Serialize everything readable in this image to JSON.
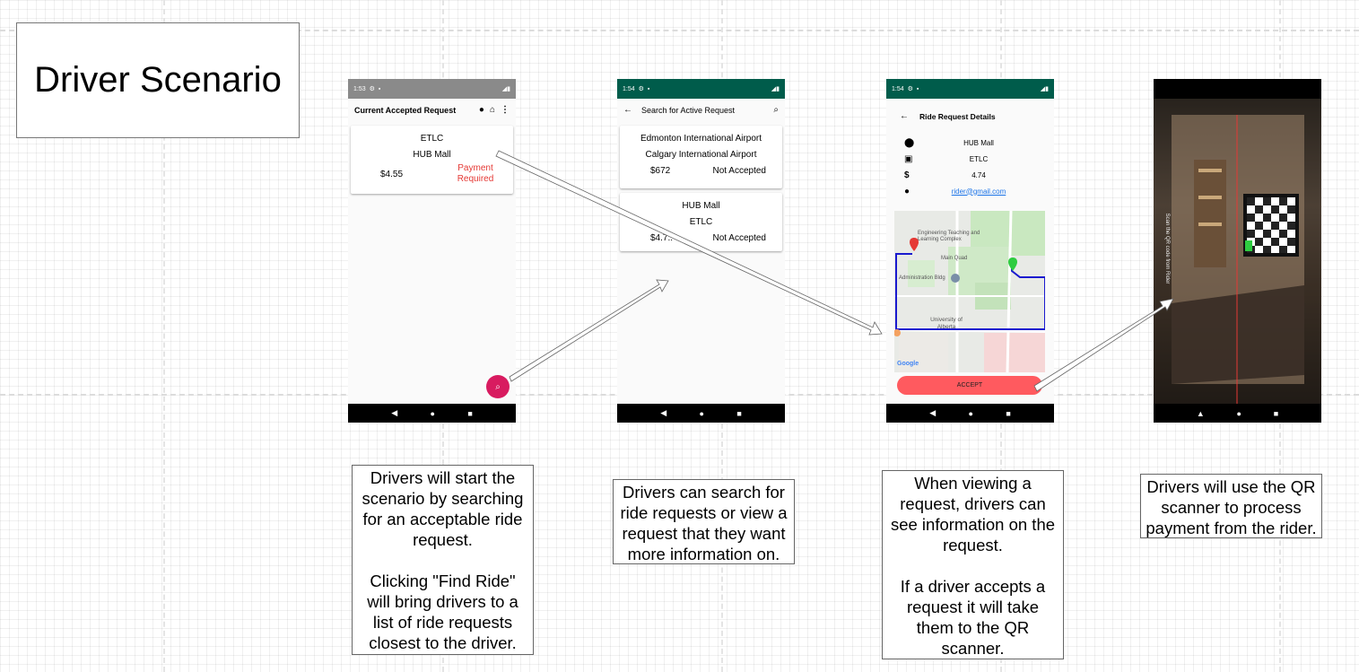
{
  "title": "Driver Scenario",
  "colors": {
    "teal_statusbar": "#005c4b",
    "grey_statusbar": "#8a8a8a",
    "payment_red": "#e53935",
    "fab_pink": "#d81b60",
    "accept_red": "#ff5a5f",
    "route_blue": "#1a1acf"
  },
  "screen1": {
    "status_time": "1:53",
    "appbar_title": "Current Accepted Request",
    "icons": [
      "account-circle-icon",
      "home-icon",
      "more-vert-icon"
    ],
    "card": {
      "from": "ETLC",
      "to": "HUB Mall",
      "price": "$4.55",
      "status": "Payment Required"
    },
    "fab_icon": "search-icon"
  },
  "screen2": {
    "status_time": "1:54",
    "appbar_title": "Search for Active Request",
    "cards": [
      {
        "from": "Edmonton International Airport",
        "to": "Calgary International Airport",
        "price": "$672",
        "status": "Not Accepted"
      },
      {
        "from": "HUB Mall",
        "to": "ETLC",
        "price": "$4.7..",
        "status": "Not Accepted"
      }
    ]
  },
  "screen3": {
    "status_time": "1:54",
    "appbar_title": "Ride Request Details",
    "details": [
      {
        "icon": "map-pin-icon",
        "value": "HUB Mall"
      },
      {
        "icon": "map-icon",
        "value": "ETLC"
      },
      {
        "icon": "dollar-icon",
        "value": "4.74"
      },
      {
        "icon": "account-icon",
        "value": "rider@gmail.com"
      }
    ],
    "map_labels": {
      "etlc": "Engineering Teaching and Learning Complex",
      "quad": "Main Quad",
      "admin": "Administration Bldg",
      "uni": "University of Alberta",
      "google": "Google"
    },
    "accept_label": "ACCEPT"
  },
  "screen4": {
    "side_text": "Scan the QR code from Rider"
  },
  "captions": {
    "c1": [
      "Drivers will start the scenario by searching for an acceptable ride request.",
      "Clicking \"Find Ride\" will bring drivers to a list of ride requests closest to the driver."
    ],
    "c2": [
      "Drivers can search for ride requests or view a request that they want more information on."
    ],
    "c3": [
      "When viewing a request, drivers can see information on the request.",
      "If a driver accepts a request it will take them to the QR scanner."
    ],
    "c4": [
      "Drivers will use the QR scanner to process payment from the rider."
    ]
  }
}
